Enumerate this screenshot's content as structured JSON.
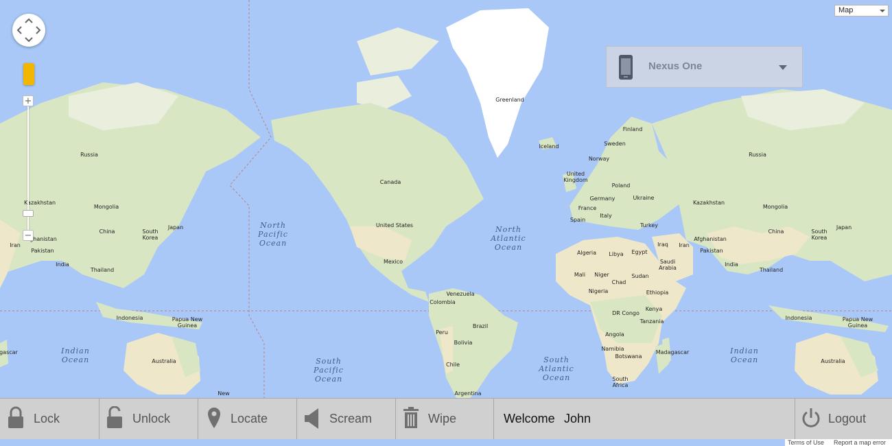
{
  "map": {
    "type_selector": "Map",
    "countries": [
      "Russia",
      "Kazakhstan",
      "Mongolia",
      "China",
      "Japan",
      "South Korea",
      "Afghanistan",
      "Iran",
      "Pakistan",
      "India",
      "Thailand",
      "Indonesia",
      "Papua New Guinea",
      "Australia",
      "New",
      "Greenland",
      "Iceland",
      "Canada",
      "United States",
      "Mexico",
      "Venezuela",
      "Colombia",
      "Brazil",
      "Peru",
      "Bolivia",
      "Chile",
      "Argentina",
      "Finland",
      "Sweden",
      "Norway",
      "United Kingdom",
      "Poland",
      "Ukraine",
      "Germany",
      "France",
      "Italy",
      "Spain",
      "Turkey",
      "Algeria",
      "Libya",
      "Egypt",
      "Iraq",
      "Saudi Arabia",
      "Mali",
      "Niger",
      "Chad",
      "Sudan",
      "Nigeria",
      "Ethiopia",
      "DR Congo",
      "Kenya",
      "Tanzania",
      "Angola",
      "Namibia",
      "Botswana",
      "Madagascar",
      "South Africa",
      "Russia",
      "Kazakhstan",
      "Mongolia",
      "China",
      "Japan",
      "South Korea",
      "Afghanistan",
      "Iran",
      "Pakistan",
      "India",
      "Thailand",
      "Indonesia",
      "Papua New Guinea",
      "Australia",
      "agascar"
    ],
    "oceans": [
      "North Pacific Ocean",
      "North Atlantic Ocean",
      "Indian Ocean",
      "South Pacific Ocean",
      "South Atlantic Ocean",
      "Indian Ocean"
    ],
    "footer": {
      "terms": "Terms of Use",
      "report": "Report a map error"
    }
  },
  "device_selector": {
    "selected": "Nexus One"
  },
  "toolbar": {
    "lock": "Lock",
    "unlock": "Unlock",
    "locate": "Locate",
    "scream": "Scream",
    "wipe": "Wipe",
    "welcome_label": "Welcome",
    "user_name": "John",
    "logout": "Logout"
  },
  "colors": {
    "ocean": "#a9c8f7",
    "land": "#d9e6c3",
    "toolbar": "#d0d0d0",
    "icon": "#707070"
  }
}
